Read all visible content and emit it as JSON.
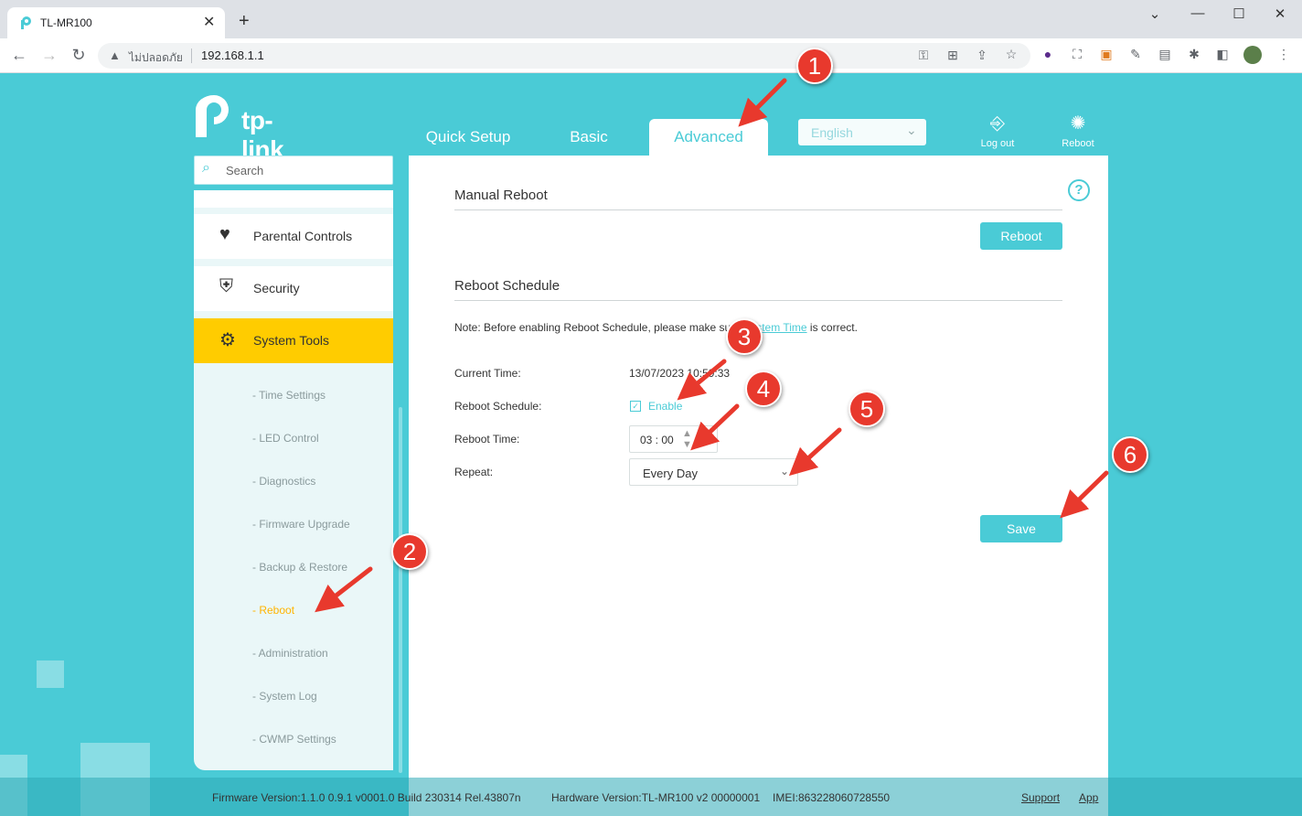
{
  "browser": {
    "tab_title": "TL-MR100",
    "security_label": "ไม่ปลอดภัย",
    "url": "192.168.1.1"
  },
  "header": {
    "brand": "tp-link",
    "tabs": [
      "Quick Setup",
      "Basic",
      "Advanced"
    ],
    "active_tab": "Advanced",
    "language": "English",
    "logout_label": "Log out",
    "reboot_label": "Reboot"
  },
  "sidebar": {
    "search_placeholder": "Search",
    "items": [
      {
        "label": "Parental Controls",
        "icon": "heart-icon"
      },
      {
        "label": "Security",
        "icon": "shield-icon"
      },
      {
        "label": "System Tools",
        "icon": "gear-icon"
      }
    ],
    "subitems": [
      "- Time Settings",
      "- LED Control",
      "- Diagnostics",
      "- Firmware Upgrade",
      "- Backup & Restore",
      "- Reboot",
      "- Administration",
      "- System Log",
      "- CWMP Settings"
    ],
    "active_subitem": "- Reboot"
  },
  "main": {
    "manual_title": "Manual Reboot",
    "reboot_button": "Reboot",
    "schedule_title": "Reboot Schedule",
    "note_prefix": "Note: Before enabling Reboot Schedule, please make sure",
    "note_link": "System Time",
    "note_suffix": "is correct.",
    "current_time_label": "Current Time:",
    "current_time_value": "13/07/2023 10:59:33",
    "schedule_label": "Reboot Schedule:",
    "enable_label": "Enable",
    "enable_checked": true,
    "reboot_time_label": "Reboot Time:",
    "reboot_time_value": "03 : 00",
    "repeat_label": "Repeat:",
    "repeat_value": "Every Day",
    "save_button": "Save"
  },
  "footer": {
    "firmware": "Firmware Version:1.1.0 0.9.1 v0001.0 Build 230314 Rel.43807n",
    "hardware": "Hardware Version:TL-MR100 v2 00000001",
    "imei": "IMEI:863228060728550",
    "support": "Support",
    "app": "App"
  },
  "annotations": [
    "1",
    "2",
    "3",
    "4",
    "5",
    "6"
  ],
  "colors": {
    "accent": "#4acbd6",
    "active_nav": "#ffcc00",
    "annotation": "#e8392d"
  }
}
